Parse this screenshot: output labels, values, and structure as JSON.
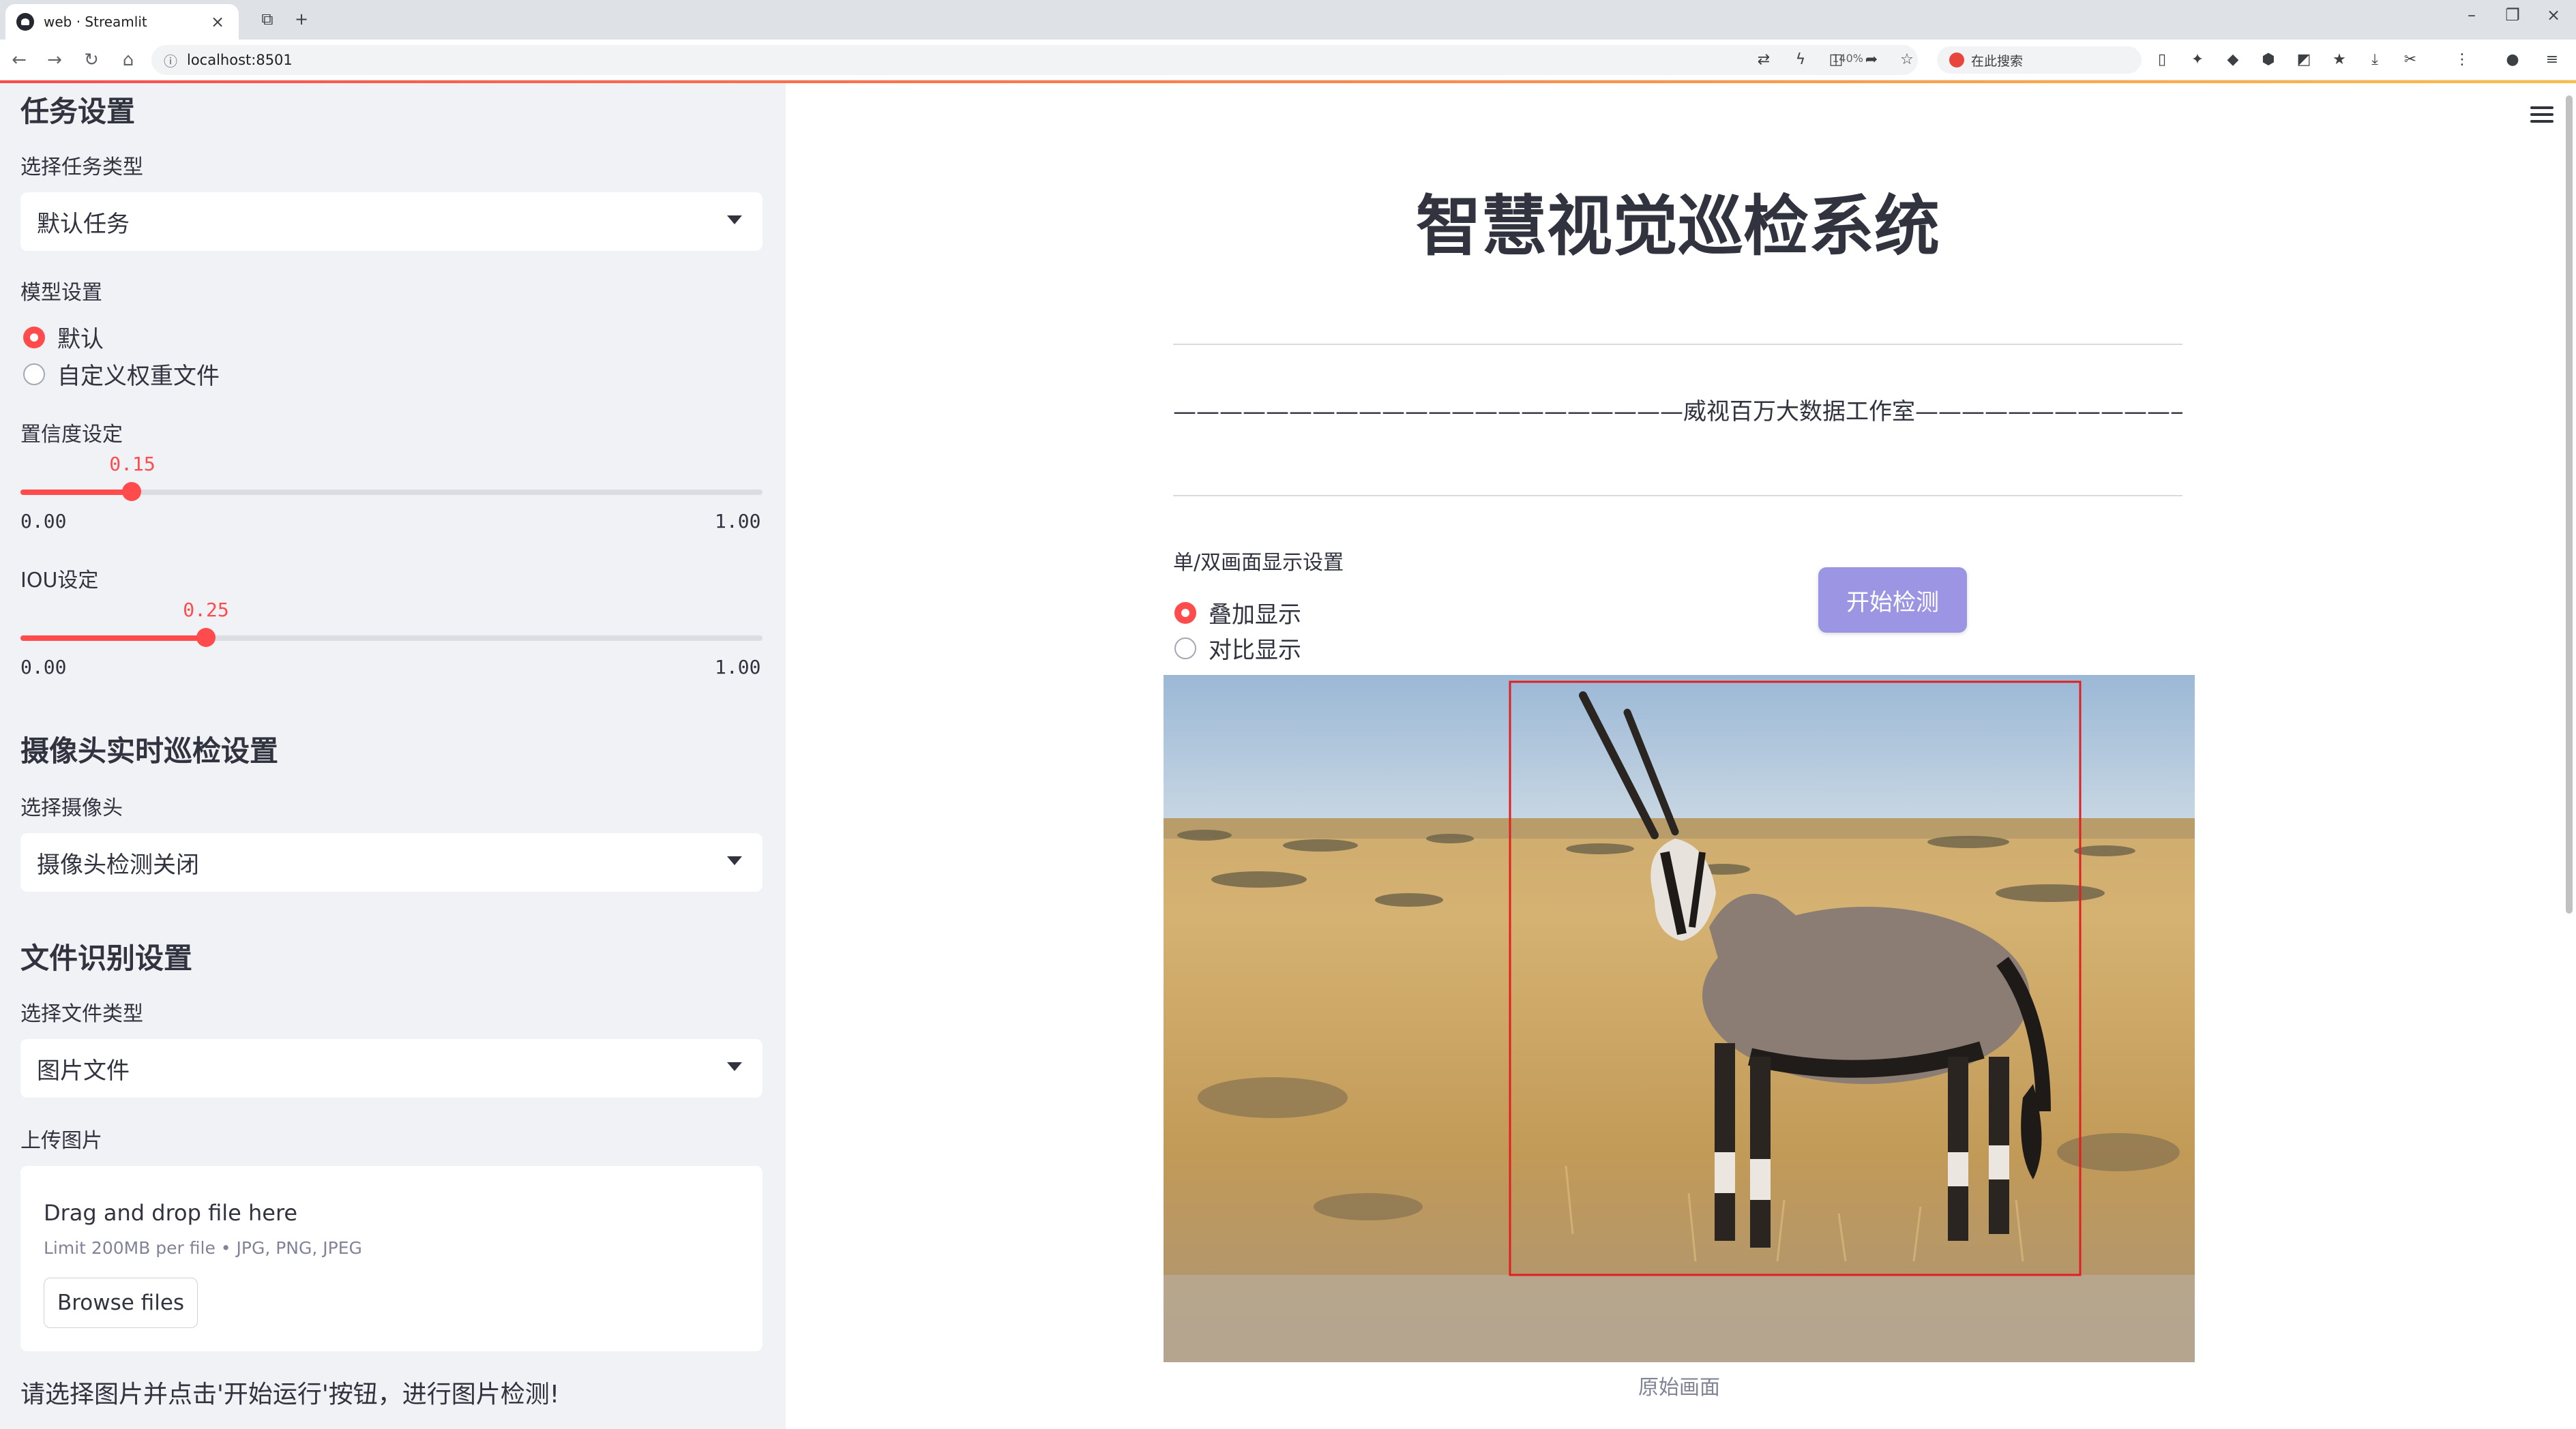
{
  "browser": {
    "tab_title": "web · Streamlit",
    "url": "localhost:8501",
    "zoom": "140%",
    "search_placeholder": "在此搜索"
  },
  "sidebar": {
    "task_heading": "任务设置",
    "task_type_label": "选择任务类型",
    "task_type_value": "默认任务",
    "model_label": "模型设置",
    "model_options": [
      {
        "label": "默认",
        "selected": true
      },
      {
        "label": "自定义权重文件",
        "selected": false
      }
    ],
    "confidence": {
      "label": "置信度设定",
      "value": "0.15",
      "fraction": 0.15,
      "min": "0.00",
      "max": "1.00"
    },
    "iou": {
      "label": "IOU设定",
      "value": "0.25",
      "fraction": 0.25,
      "min": "0.00",
      "max": "1.00"
    },
    "camera_heading": "摄像头实时巡检设置",
    "camera_label": "选择摄像头",
    "camera_value": "摄像头检测关闭",
    "file_heading": "文件识别设置",
    "file_type_label": "选择文件类型",
    "file_type_value": "图片文件",
    "upload_label": "上传图片",
    "upload_main": "Drag and drop file here",
    "upload_sub": "Limit 200MB per file • JPG, PNG, JPEG",
    "browse_label": "Browse files",
    "note": "请选择图片并点击'开始运行'按钮，进行图片检测!"
  },
  "main": {
    "title": "智慧视觉巡检系统",
    "subtitle": "——————————————————————威视百万大数据工作室———————————————————————",
    "display_label": "单/双画面显示设置",
    "display_options": [
      {
        "label": "叠加显示",
        "selected": true
      },
      {
        "label": "对比显示",
        "selected": false
      }
    ],
    "start_button": "开始检测",
    "image_caption": "原始画面"
  },
  "colors": {
    "accent": "#ff4b4b",
    "sidebar_bg": "#f0f2f6",
    "button": "#9b95e3",
    "detection_box": "#e02020"
  }
}
